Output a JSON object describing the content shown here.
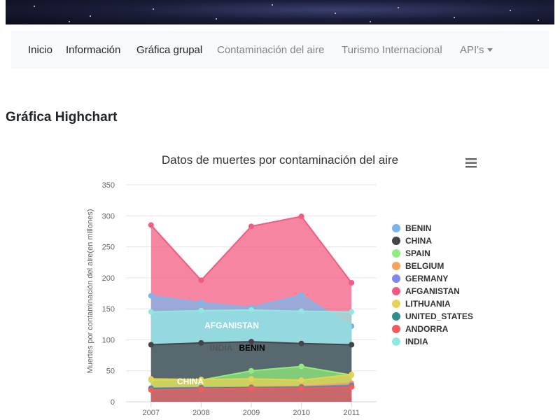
{
  "navbar": {
    "items": [
      {
        "label": "Inicio"
      },
      {
        "label": "Información"
      },
      {
        "label": "Gráfica grupal"
      },
      {
        "label": "Contaminación del aire"
      },
      {
        "label": "Turismo Internacional"
      },
      {
        "label": "API's"
      }
    ]
  },
  "page": {
    "heading": "Gráfica Highchart"
  },
  "chart_data": {
    "type": "area",
    "title": "Datos de muertes por contaminación del aire",
    "ylabel": "Muertes por contaminación del aire(en millones)",
    "xlabel": "",
    "x": [
      2007,
      2008,
      2009,
      2010,
      2011
    ],
    "ylim": [
      0,
      350
    ],
    "yticks": [
      0,
      50,
      100,
      150,
      200,
      250,
      300,
      350
    ],
    "grid": true,
    "legend_position": "right",
    "menu_icon": "hamburger-menu-icon",
    "series": [
      {
        "name": "BENIN",
        "color": "#7cb5ec",
        "values": [
          171,
          160,
          152,
          172,
          122
        ]
      },
      {
        "name": "CHINA",
        "color": "#434348",
        "values": [
          92,
          95,
          97,
          94,
          92
        ]
      },
      {
        "name": "SPAIN",
        "color": "#90ed7d",
        "values": [
          35,
          35,
          50,
          57,
          43
        ]
      },
      {
        "name": "BELGIUM",
        "color": "#f7a35c",
        "values": [
          20,
          22,
          24,
          25,
          30
        ]
      },
      {
        "name": "GERMANY",
        "color": "#8085e9",
        "values": [
          22,
          23,
          23,
          24,
          27
        ]
      },
      {
        "name": "AFGANISTAN",
        "color": "#f15c80",
        "values": [
          285,
          196,
          283,
          299,
          192
        ]
      },
      {
        "name": "LITHUANIA",
        "color": "#e4d354",
        "values": [
          37,
          36,
          37,
          35,
          44
        ]
      },
      {
        "name": "UNITED_STATES",
        "color": "#2b908f",
        "values": [
          21,
          22,
          23,
          23,
          25
        ]
      },
      {
        "name": "ANDORRA",
        "color": "#f45b5b",
        "values": [
          19,
          21,
          22,
          22,
          24
        ]
      },
      {
        "name": "INDIA",
        "color": "#91e8e1",
        "values": [
          145,
          147,
          148,
          146,
          145
        ]
      }
    ],
    "data_labels": [
      {
        "text": "AFGANISTAN",
        "series": "AFGANISTAN"
      },
      {
        "text": "INDIA",
        "series": "INDIA"
      },
      {
        "text": "BENIN",
        "series": "BENIN"
      },
      {
        "text": "CHINA",
        "series": "CHINA"
      }
    ]
  }
}
